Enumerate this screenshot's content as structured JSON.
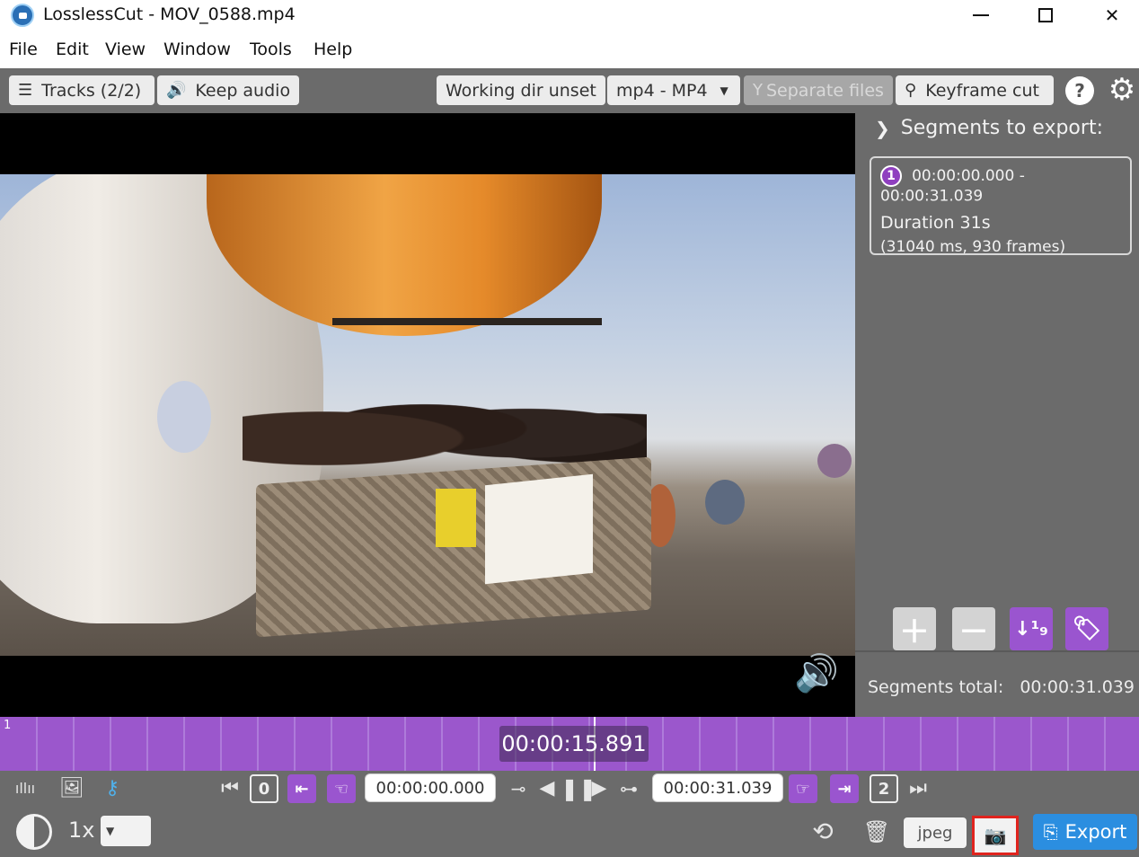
{
  "window": {
    "title": "LosslessCut - MOV_0588.mp4",
    "minimize_glyph": "—",
    "maximize_glyph": "☐",
    "close_glyph": "✕"
  },
  "menu": {
    "items": [
      "File",
      "Edit",
      "View",
      "Window",
      "Tools",
      "Help"
    ]
  },
  "toolbar": {
    "tracks_label": "Tracks (2/2)",
    "keep_audio_label": "Keep audio",
    "working_dir_label": "Working dir unset",
    "format_label": "mp4 - MP4",
    "separate_files_label": "Separate files",
    "keyframe_cut_label": "Keyframe cut",
    "help_glyph": "?",
    "settings_icon": "gear-icon"
  },
  "segments_panel": {
    "header": "Segments to export:",
    "segments": [
      {
        "number": "1",
        "time_range": "00:00:00.000 - 00:00:31.039",
        "duration": "Duration 31s",
        "frames": "(31040 ms, 930 frames)"
      }
    ],
    "total_label": "Segments total:",
    "total_value": "00:00:31.039"
  },
  "timeline": {
    "segment_label": "1",
    "current_time": "00:00:15.891",
    "accent_color": "#9b57cc"
  },
  "controls": {
    "cut_start_time": "00:00:00.000",
    "cut_end_time": "00:00:31.039",
    "start_segment_number": "0",
    "end_segment_number": "2",
    "speed": "1x",
    "capture_format": "jpeg",
    "export_label": "Export"
  },
  "colors": {
    "purple_accent": "#9a55cf",
    "export_blue": "#2b8ee0",
    "snapshot_highlight": "#e0241e",
    "background": "#6b6b6b"
  }
}
